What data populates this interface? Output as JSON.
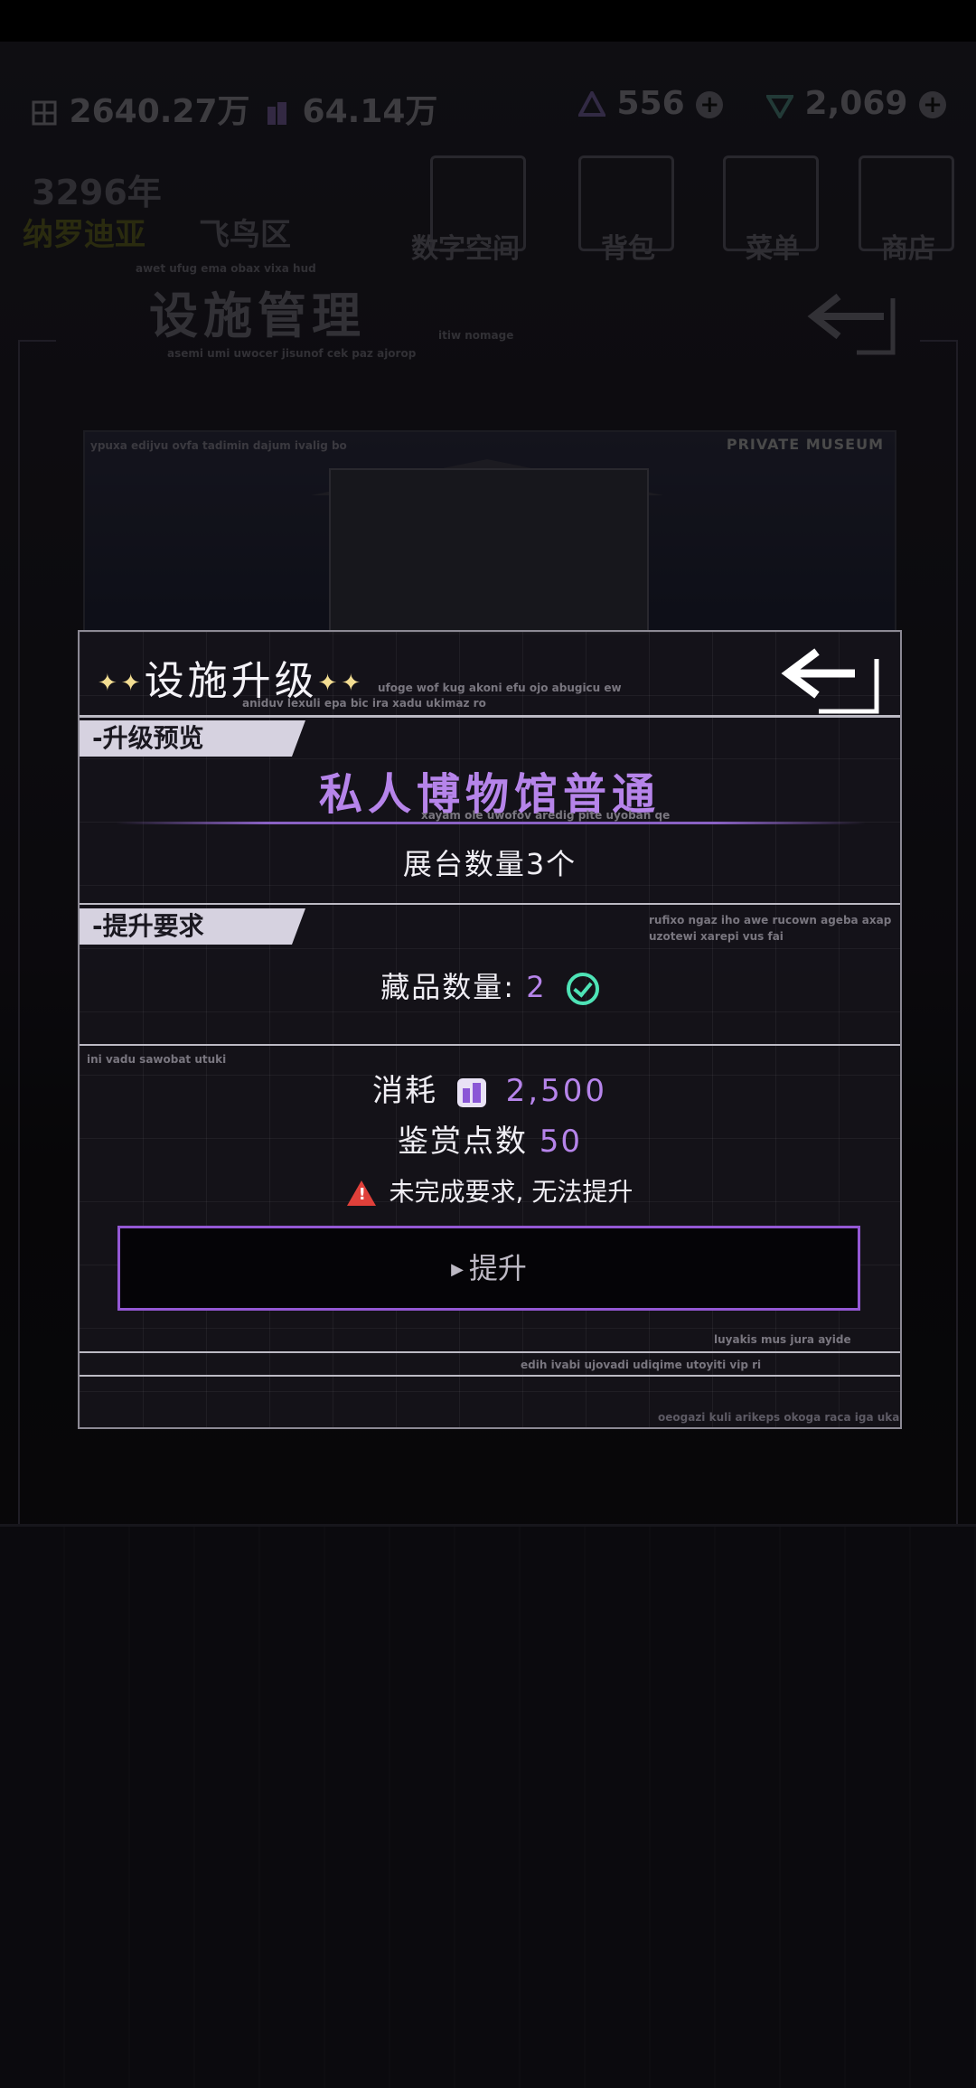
{
  "hud": {
    "resource_a": "2640.27万",
    "resource_b": "64.14万",
    "resource_c": "556",
    "resource_d": "2,069"
  },
  "header": {
    "year": "3296年",
    "location_primary": "纳罗迪亚",
    "location_secondary": "飞鸟区",
    "page_title": "设施管理",
    "nav": [
      {
        "label": "数字空间",
        "icon": "cube-icon"
      },
      {
        "label": "背包",
        "icon": "bag-icon"
      },
      {
        "label": "菜单",
        "icon": "menu-icon"
      },
      {
        "label": "商店",
        "icon": "cart-icon"
      }
    ],
    "deco_1": "awet ufug ema obax vixa hud",
    "deco_2": "asemi umi uwocer jisunof cek paz ajorop",
    "deco_3": "itiw nomage"
  },
  "banner": {
    "label": "PRIVATE MUSEUM",
    "deco": "ypuxa edijvu ovfa tadimin dajum ivalig bo"
  },
  "dialog": {
    "title": "设施升级",
    "title_deco_1": "ufoge wof kug akoni efu ojo abugicu ew",
    "title_deco_2": "aniduv lexuli epa bic ira xadu ukimaz ro",
    "preview_tag": "-升级预览",
    "facility_name": "私人博物馆普通",
    "name_deco": "xayam ole uwofov aredig pite uyoban qe",
    "booth_count": "展台数量3个",
    "requirement_tag": "-提升要求",
    "req_deco_1": "rufixo ngaz iho awe rucown ageba axap",
    "req_deco_2": "uzotewi xarepi vus fai",
    "collection_label": "藏品数量:",
    "collection_value": "2",
    "cost_deco": "ini vadu sawobat utuki",
    "cost_label": "消耗",
    "cost_value": "2,500",
    "points_label": "鉴赏点数",
    "points_value": "50",
    "warning": "未完成要求, 无法提升",
    "upgrade_button": "提升",
    "footer_deco_1": "luyakis mus jura ayide",
    "footer_deco_2": "edih ivabi ujovadi udiqime utoyiti vip ri",
    "footer_deco_3": "oeogazi kuli arikeps okoga raca iga uka"
  },
  "colors": {
    "accent_purple": "#b684ea",
    "button_border": "#9458d4",
    "check_green": "#4ee3b6",
    "warn_red": "#e0403a",
    "star_gold": "#f3dd92"
  }
}
